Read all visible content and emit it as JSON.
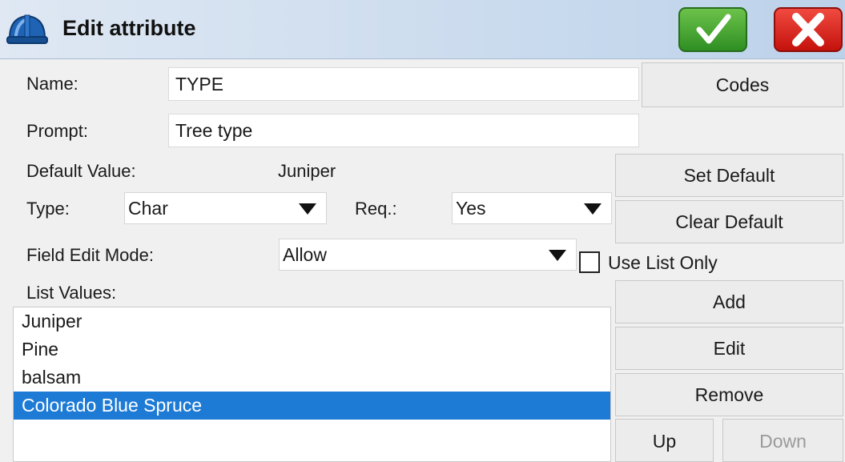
{
  "header": {
    "title": "Edit attribute",
    "app_icon": "blue-hard-hat-icon",
    "ok_icon": "checkmark-icon",
    "cancel_icon": "x-icon",
    "ok_color": "#3ea82e",
    "cancel_color": "#e2231a"
  },
  "form": {
    "name_label": "Name:",
    "name_value": "TYPE",
    "prompt_label": "Prompt:",
    "prompt_value": "Tree type",
    "default_label": "Default Value:",
    "default_value": "Juniper",
    "type_label": "Type:",
    "type_value": "Char",
    "req_label": "Req.:",
    "req_value": "Yes",
    "edit_mode_label": "Field Edit Mode:",
    "edit_mode_value": "Allow",
    "use_list_only_label": "Use List Only",
    "use_list_only_checked": false,
    "list_values_label": "List Values:"
  },
  "buttons": {
    "codes": "Codes",
    "set_default": "Set Default",
    "clear_default": "Clear Default",
    "add": "Add",
    "edit": "Edit",
    "remove": "Remove",
    "up": "Up",
    "down": "Down"
  },
  "list": {
    "items": [
      "Juniper",
      "Pine",
      "balsam",
      "Colorado Blue Spruce"
    ],
    "selected_index": 3,
    "selection_color": "#1e7bd5"
  }
}
